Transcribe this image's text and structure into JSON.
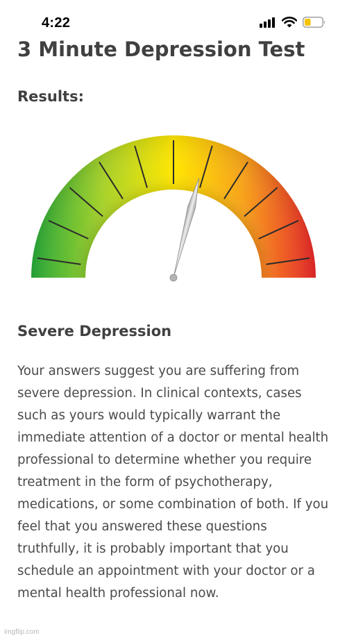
{
  "status_bar": {
    "time": "4:22",
    "icons": [
      "cellular-signal-icon",
      "wifi-icon",
      "battery-low-icon"
    ],
    "battery_color": "#f5c400"
  },
  "header": {
    "title": "3 Minute Depression Test"
  },
  "results": {
    "heading": "Results:"
  },
  "gauge": {
    "level": 0.58,
    "colors": {
      "low": "#1fa83a",
      "lower_mid": "#a8d22a",
      "mid": "#ffe600",
      "upper_mid": "#f7a21b",
      "high": "#e8202a"
    },
    "needle_color": "#c8c8c8"
  },
  "result": {
    "title": "Severe Depression",
    "body": "Your answers suggest you are suffering from severe depression. In clinical contexts, cases such as yours would typically warrant the immediate attention of a doctor or mental health professional to determine whether you require treatment in the form of psychotherapy, medications, or some combination of both. If you feel that you answered these questions truthfully, it is probably important that you schedule an appointment with your doctor or a mental health professional now."
  },
  "watermark": "imgflip.com"
}
